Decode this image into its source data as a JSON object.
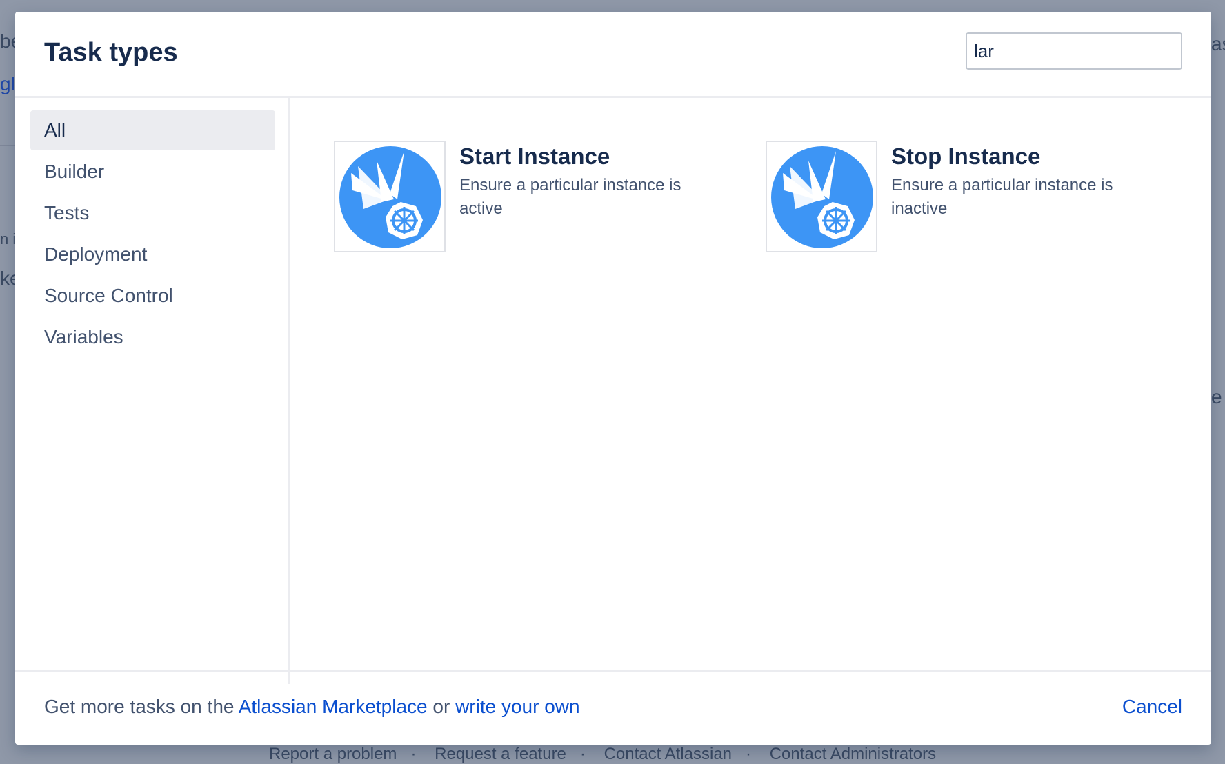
{
  "background": {
    "fragments": [
      "be",
      "glo",
      "n i",
      "ke",
      "e",
      "as"
    ],
    "footer_links": [
      "Report a problem",
      "Request a feature",
      "Contact Atlassian",
      "Contact Administrators"
    ],
    "separator": "·"
  },
  "dialog": {
    "title": "Task types",
    "search": {
      "value": "lar",
      "placeholder": ""
    }
  },
  "sidebar": {
    "items": [
      {
        "label": "All",
        "active": true
      },
      {
        "label": "Builder"
      },
      {
        "label": "Tests"
      },
      {
        "label": "Deployment"
      },
      {
        "label": "Source Control"
      },
      {
        "label": "Variables"
      }
    ]
  },
  "tasks": [
    {
      "title": "Start Instance",
      "description": "Ensure a particular instance is active",
      "icon": "kubernetes-instance-icon"
    },
    {
      "title": "Stop Instance",
      "description": "Ensure a particular instance is inactive",
      "icon": "kubernetes-instance-icon"
    }
  ],
  "footer": {
    "prefix": "Get more tasks on the",
    "marketplace_link": "Atlassian Marketplace",
    "or": "or",
    "write_link": "write your own",
    "cancel_label": "Cancel"
  },
  "colors": {
    "accent": "#0b4fcf",
    "icon_blue": "#3d95f5",
    "overlay": "#8f98a8"
  }
}
